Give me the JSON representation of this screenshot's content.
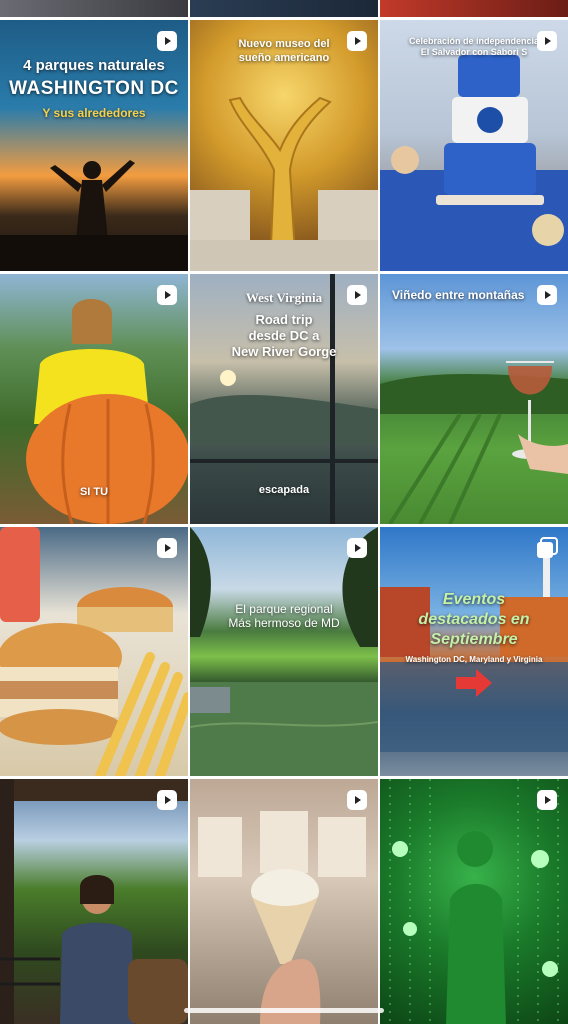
{
  "grid": {
    "tiles": [
      {
        "id": "dc-parks",
        "lines": [
          "4 parques naturales",
          "WASHINGTON DC",
          "Y sus alrededores"
        ]
      },
      {
        "id": "museo",
        "lines": [
          "Nuevo museo del",
          "sueño americano"
        ]
      },
      {
        "id": "cake",
        "lines": [
          "Celebración de independencia",
          "El Salvador con Sabori S"
        ]
      },
      {
        "id": "pumpkin",
        "lines": [
          "SI TU"
        ]
      },
      {
        "id": "west-virginia",
        "lines": [
          "West Virginia",
          "Road trip",
          "desde DC a",
          "New River Gorge",
          "escapada"
        ]
      },
      {
        "id": "vinedo",
        "lines": [
          "Viñedo entre montañas"
        ]
      },
      {
        "id": "burger",
        "lines": []
      },
      {
        "id": "parque-md",
        "lines": [
          "El parque regional",
          "Más hermoso de MD"
        ]
      },
      {
        "id": "eventos",
        "lines": [
          "Eventos",
          "destacados en",
          "Septiembre",
          "Washington DC, Maryland y Virginia"
        ]
      },
      {
        "id": "winery-woman",
        "lines": []
      },
      {
        "id": "ice-cream",
        "lines": []
      },
      {
        "id": "green-lights",
        "lines": []
      }
    ]
  },
  "icons": {
    "reel": "reel-icon",
    "carousel": "carousel-icon"
  },
  "colors": {
    "accent_gold": "#f2c94c",
    "dc_title": "#ffffff",
    "parks_highlight": "#f5a623",
    "events_green": "#2fa84f"
  }
}
